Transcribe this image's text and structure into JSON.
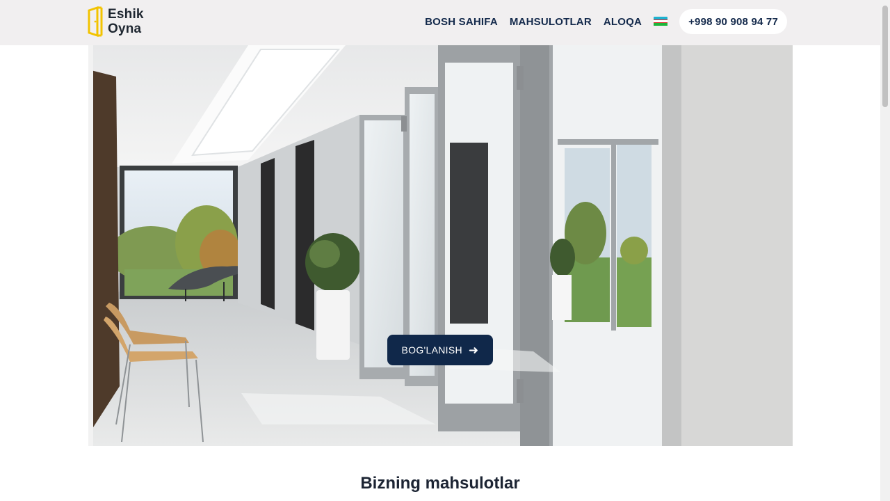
{
  "brand": {
    "line1": "Eshik",
    "line2": "Oyna",
    "icon": "door-window-logo-icon",
    "accent": "#f2c300"
  },
  "nav": {
    "items": [
      {
        "label": "BOSH SAHIFA"
      },
      {
        "label": "MAHSULOTLAR"
      },
      {
        "label": "ALOQA"
      }
    ],
    "language_flag": "uzbekistan-flag-icon",
    "phone": "+998 90 908 94 77"
  },
  "hero": {
    "image": "office-corridor-glass-doors",
    "button_label": "BOG'LANISH",
    "button_icon": "arrow-right-icon",
    "button_color": "#10284a"
  },
  "products": {
    "title": "Bizning mahsulotlar"
  }
}
